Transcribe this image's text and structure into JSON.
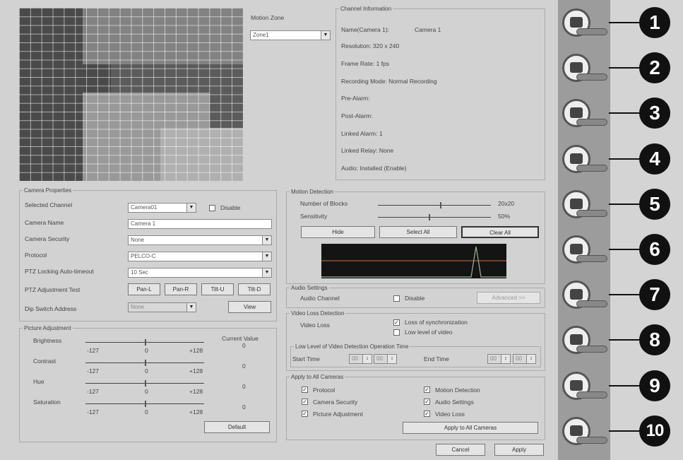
{
  "motion_zone": {
    "label": "Motion Zone",
    "value": "Zone1"
  },
  "channel_info": {
    "title": "Channel Information",
    "name_label": "Name(Camera 1):",
    "name_value": "Camera 1",
    "resolution": "Resolution: 320 x 240",
    "frame_rate": "Frame Rate: 1 fps",
    "recording_mode": "Recording Mode: Normal Recording",
    "pre_alarm": "Pre-Alarm:",
    "post_alarm": "Post-Alarm:",
    "linked_alarm": "Linked Alarm: 1",
    "linked_relay": "Linked Relay: None",
    "audio": "Audio: Installed (Enable)"
  },
  "camera_properties": {
    "title": "Camera Properties",
    "selected_channel_label": "Selected Channel",
    "selected_channel_value": "Camera01",
    "disable_label": "Disable",
    "camera_name_label": "Camera Name",
    "camera_name_value": "Camera 1",
    "camera_security_label": "Camera Security",
    "camera_security_value": "None",
    "protocol_label": "Protocol",
    "protocol_value": "PELCO-C",
    "ptz_locking_label": "PTZ Locking Auto-timeout",
    "ptz_locking_value": "10 Sec",
    "ptz_adjust_label": "PTZ Adjustment Test",
    "pan_l": "Pan-L",
    "pan_r": "Pan-R",
    "tilt_u": "Tilt-U",
    "tilt_d": "Tilt-D",
    "dip_label": "Dip Switch Address",
    "dip_value": "None",
    "view_button": "View"
  },
  "picture_adjustment": {
    "title": "Picture Adjustment",
    "current_value_label": "Current Value",
    "rows": [
      {
        "label": "Brightness",
        "min": "-127",
        "mid": "0",
        "max": "+128",
        "current": "0",
        "level": 0.5
      },
      {
        "label": "Contrast",
        "min": "-127",
        "mid": "0",
        "max": "+128",
        "current": "0",
        "level": 0.5
      },
      {
        "label": "Hue",
        "min": "-127",
        "mid": "0",
        "max": "+128",
        "current": "0",
        "level": 0.5
      },
      {
        "label": "Saturation",
        "min": "-127",
        "mid": "0",
        "max": "+128",
        "current": "0",
        "level": 0.5
      }
    ],
    "default_button": "Default"
  },
  "motion_detection": {
    "title": "Motion Detection",
    "blocks_label": "Number of Blocks",
    "blocks_value": "20x20",
    "blocks_level": 0.55,
    "sensitivity_label": "Sensitivity",
    "sensitivity_value": "50%",
    "sensitivity_level": 0.45,
    "hide_button": "Hide",
    "select_all_button": "Select All",
    "clear_all_button": "Clear All"
  },
  "audio_settings": {
    "title": "Audio Settings",
    "channel_label": "Audio Channel",
    "disable_label": "Disable",
    "advanced_button": "Advanced >>"
  },
  "video_loss": {
    "title": "Video Loss Detection",
    "label": "Video Loss",
    "sync_label": "Loss of synchronization",
    "level_label": "Low level of video",
    "time_title": "Low Level of Video Detection Operation Time",
    "start_label": "Start Time",
    "end_label": "End Time",
    "start_h": "00",
    "start_m": "00",
    "end_h": "00",
    "end_m": "00"
  },
  "apply_all": {
    "title": "Apply to All Cameras",
    "protocol": "Protocol",
    "camera_security": "Camera Security",
    "picture_adjustment": "Picture Adjustment",
    "motion_detection": "Motion Detection",
    "audio_settings": "Audio Settings",
    "video_loss": "Video Loss",
    "apply_button": "Apply to All Cameras"
  },
  "footer": {
    "cancel": "Cancel",
    "apply": "Apply"
  },
  "check_glyph": "✓",
  "sidebar": {
    "buttons": [
      {
        "icon": "camera-icon"
      },
      {
        "icon": "link-icon"
      },
      {
        "icon": "record-icon"
      },
      {
        "icon": "network-icon"
      },
      {
        "icon": "alarm-icon"
      },
      {
        "icon": "user-icon"
      },
      {
        "icon": "schedule-icon"
      },
      {
        "icon": "monitor-icon"
      },
      {
        "icon": "display-icon"
      },
      {
        "icon": "email-icon"
      }
    ],
    "callouts": [
      "1",
      "2",
      "3",
      "4",
      "5",
      "6",
      "7",
      "8",
      "9",
      "10"
    ]
  }
}
